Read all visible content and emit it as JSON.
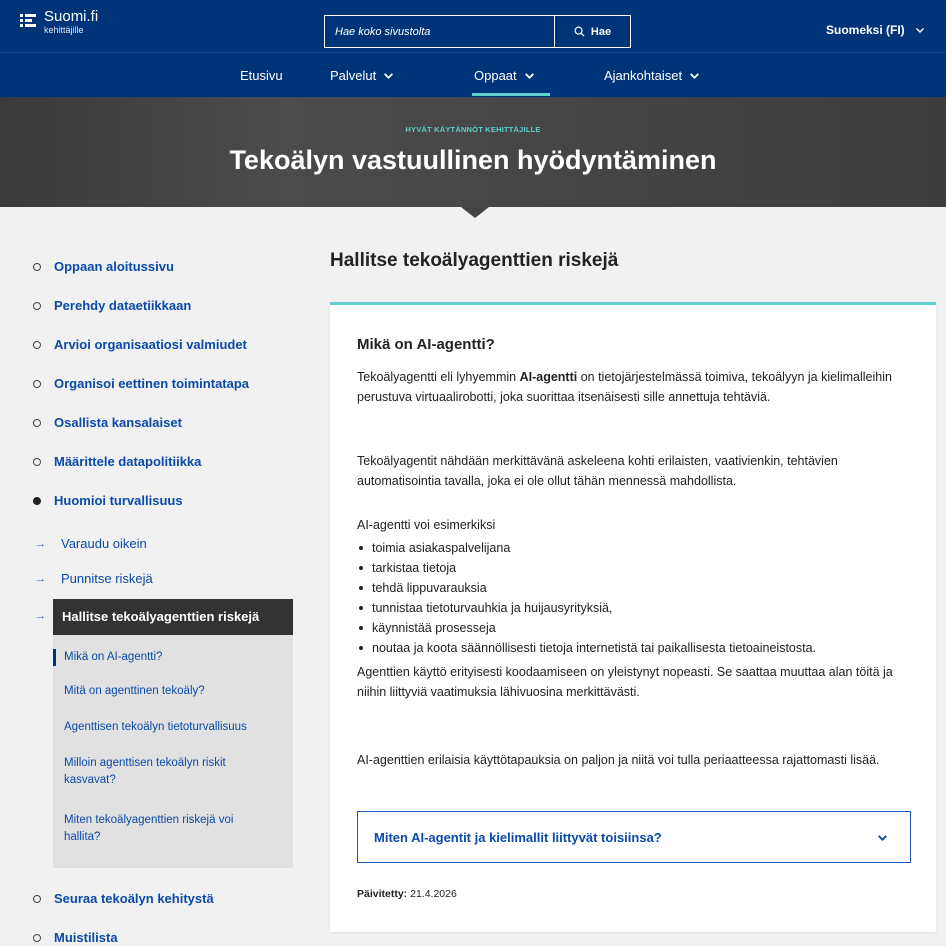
{
  "header": {
    "logo_title": "Suomi.fi",
    "logo_subtitle": "kehittäjille",
    "search_placeholder": "Hae koko sivustolta",
    "search_button": "Hae",
    "language": "Suomeksi (FI)"
  },
  "nav": {
    "items": [
      {
        "label": "Etusivu",
        "has_dropdown": false
      },
      {
        "label": "Palvelut",
        "has_dropdown": true
      },
      {
        "label": "Oppaat",
        "has_dropdown": true,
        "active": true
      },
      {
        "label": "Ajankohtaiset",
        "has_dropdown": true
      }
    ]
  },
  "hero": {
    "kicker": "HYVÄT KÄYTÄNNÖT KEHITTÄJILLE",
    "title": "Tekoälyn vastuullinen hyödyntäminen"
  },
  "sidebar": {
    "items": [
      "Oppaan aloitussivu",
      "Perehdy dataetiikkaan",
      "Arvioi organisaatiosi valmiudet",
      "Organisoi eettinen toimintatapa",
      "Osallista kansalaiset",
      "Määrittele datapolitiikka",
      "Huomioi turvallisuus"
    ],
    "sub_items": [
      "Varaudu oikein",
      "Punnitse riskejä"
    ],
    "current": "Hallitse tekoälyagenttien riskejä",
    "subnav": [
      "Mikä on AI-agentti?",
      "Mitä on agenttinen tekoäly?",
      "Agenttisen tekoälyn tietoturvallisuus",
      "Milloin agenttisen tekoälyn riskit kasvavat?",
      "Miten tekoälyagenttien riskejä voi hallita?"
    ],
    "after": [
      "Seuraa tekoälyn kehitystä",
      "Muistilista"
    ]
  },
  "main": {
    "title": "Hallitse tekoälyagenttien riskejä",
    "section_title": "Mikä on AI-agentti?",
    "p1_before": "Tekoälyagentti eli lyhyemmin ",
    "p1_bold": "AI-agentti",
    "p1_after": " on tietojärjestelmässä toimiva, tekoälyyn ja kielimalleihin perustuva virtuaalirobotti, joka suorittaa itsenäisesti sille annettuja tehtäviä.",
    "p2": "Tekoälyagentit nähdään merkittävänä askeleena kohti erilaisten, vaativienkin, tehtävien automatisointia tavalla, joka ei ole ollut tähän mennessä mahdollista.",
    "list_intro": "AI-agentti voi esimerkiksi",
    "list": [
      "toimia asiakaspalvelijana",
      "tarkistaa tietoja",
      "tehdä lippuvarauksia",
      "tunnistaa tietoturvauhkia ja huijausyrityksiä,",
      "käynnistää prosesseja",
      "noutaa ja koota säännöllisesti tietoja internetistä tai paikallisesta tietoaineistosta."
    ],
    "p3": "Agenttien käyttö erityisesti koodaamiseen on yleistynyt nopeasti. Se saattaa muuttaa alan töitä ja niihin liittyviä vaatimuksia lähivuosina merkittävästi.",
    "p4": "AI-agenttien erilaisia käyttötapauksia on paljon ja niitä voi tulla periaatteessa rajattomasti lisää.",
    "accordion": "Miten AI-agentit ja kielimallit liittyvät toisiinsa?",
    "updated_label": "Päivitetty:",
    "updated_value": "21.4.2026"
  },
  "colors": {
    "header": "#003479",
    "accent": "#5fd0cb",
    "link": "#0a4aa8",
    "hero": "#434343"
  }
}
